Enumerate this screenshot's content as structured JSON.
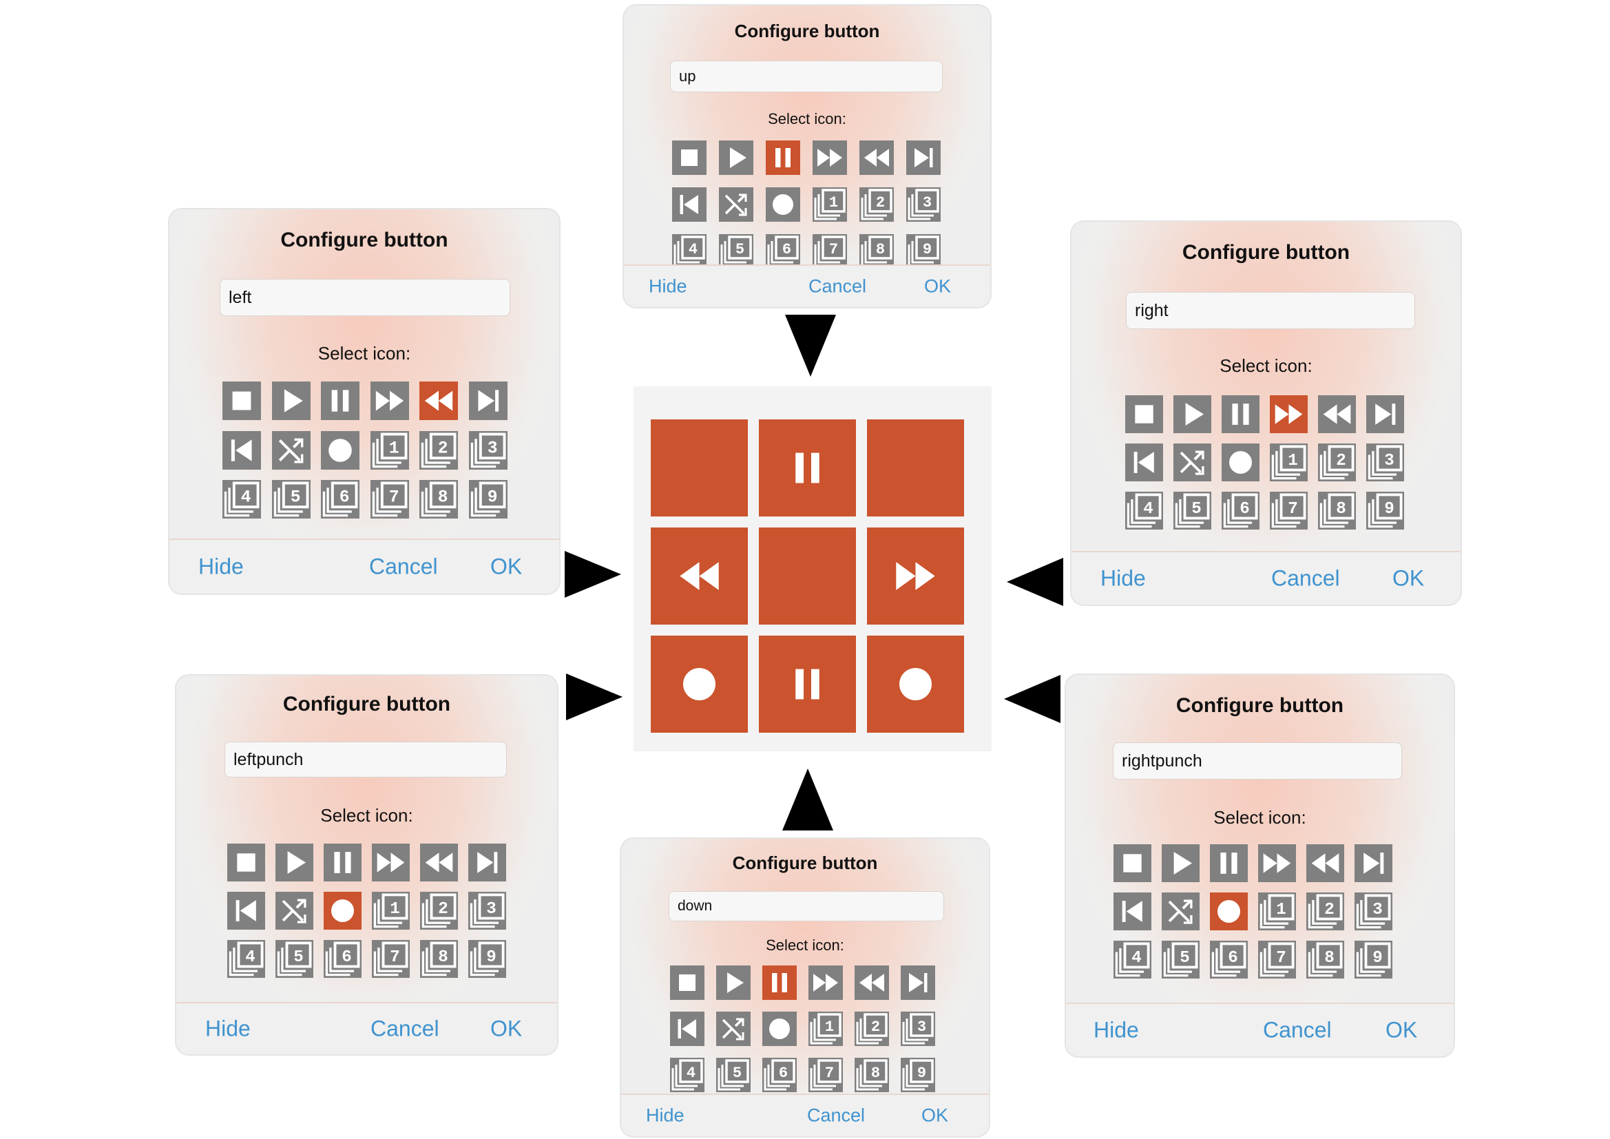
{
  "accent_color": "#cb532d",
  "icon_tile_color": "#808080",
  "link_color": "#3f93cf",
  "icon_set": [
    "stop-icon",
    "play-icon",
    "pause-icon",
    "fast-forward-icon",
    "rewind-icon",
    "skip-next-icon",
    "skip-previous-icon",
    "shuffle-icon",
    "record-icon",
    "layer-1-icon",
    "layer-2-icon",
    "layer-3-icon",
    "layer-4-icon",
    "layer-5-icon",
    "layer-6-icon",
    "layer-7-icon",
    "layer-8-icon",
    "layer-9-icon"
  ],
  "dialogs": {
    "up": {
      "title": "Configure button",
      "name_value": "up",
      "select_label": "Select icon:",
      "selected_icon": "pause-icon",
      "hide": "Hide",
      "cancel": "Cancel",
      "ok": "OK"
    },
    "left": {
      "title": "Configure button",
      "name_value": "left",
      "select_label": "Select icon:",
      "selected_icon": "rewind-icon",
      "hide": "Hide",
      "cancel": "Cancel",
      "ok": "OK"
    },
    "right": {
      "title": "Configure button",
      "name_value": "right",
      "select_label": "Select icon:",
      "selected_icon": "fast-forward-icon",
      "hide": "Hide",
      "cancel": "Cancel",
      "ok": "OK"
    },
    "leftpunch": {
      "title": "Configure button",
      "name_value": "leftpunch",
      "select_label": "Select icon:",
      "selected_icon": "record-icon",
      "hide": "Hide",
      "cancel": "Cancel",
      "ok": "OK"
    },
    "rightpunch": {
      "title": "Configure button",
      "name_value": "rightpunch",
      "select_label": "Select icon:",
      "selected_icon": "record-icon",
      "hide": "Hide",
      "cancel": "Cancel",
      "ok": "OK"
    },
    "down": {
      "title": "Configure button",
      "name_value": "down",
      "select_label": "Select icon:",
      "selected_icon": "pause-icon",
      "hide": "Hide",
      "cancel": "Cancel",
      "ok": "OK"
    }
  },
  "controller_grid": [
    {
      "slot": "top-left",
      "icon": "none"
    },
    {
      "slot": "up",
      "icon": "pause-icon"
    },
    {
      "slot": "top-right",
      "icon": "none"
    },
    {
      "slot": "left",
      "icon": "rewind-icon"
    },
    {
      "slot": "center",
      "icon": "none"
    },
    {
      "slot": "right",
      "icon": "fast-forward-icon"
    },
    {
      "slot": "leftpunch",
      "icon": "record-icon"
    },
    {
      "slot": "down",
      "icon": "pause-icon"
    },
    {
      "slot": "rightpunch",
      "icon": "record-icon"
    }
  ]
}
